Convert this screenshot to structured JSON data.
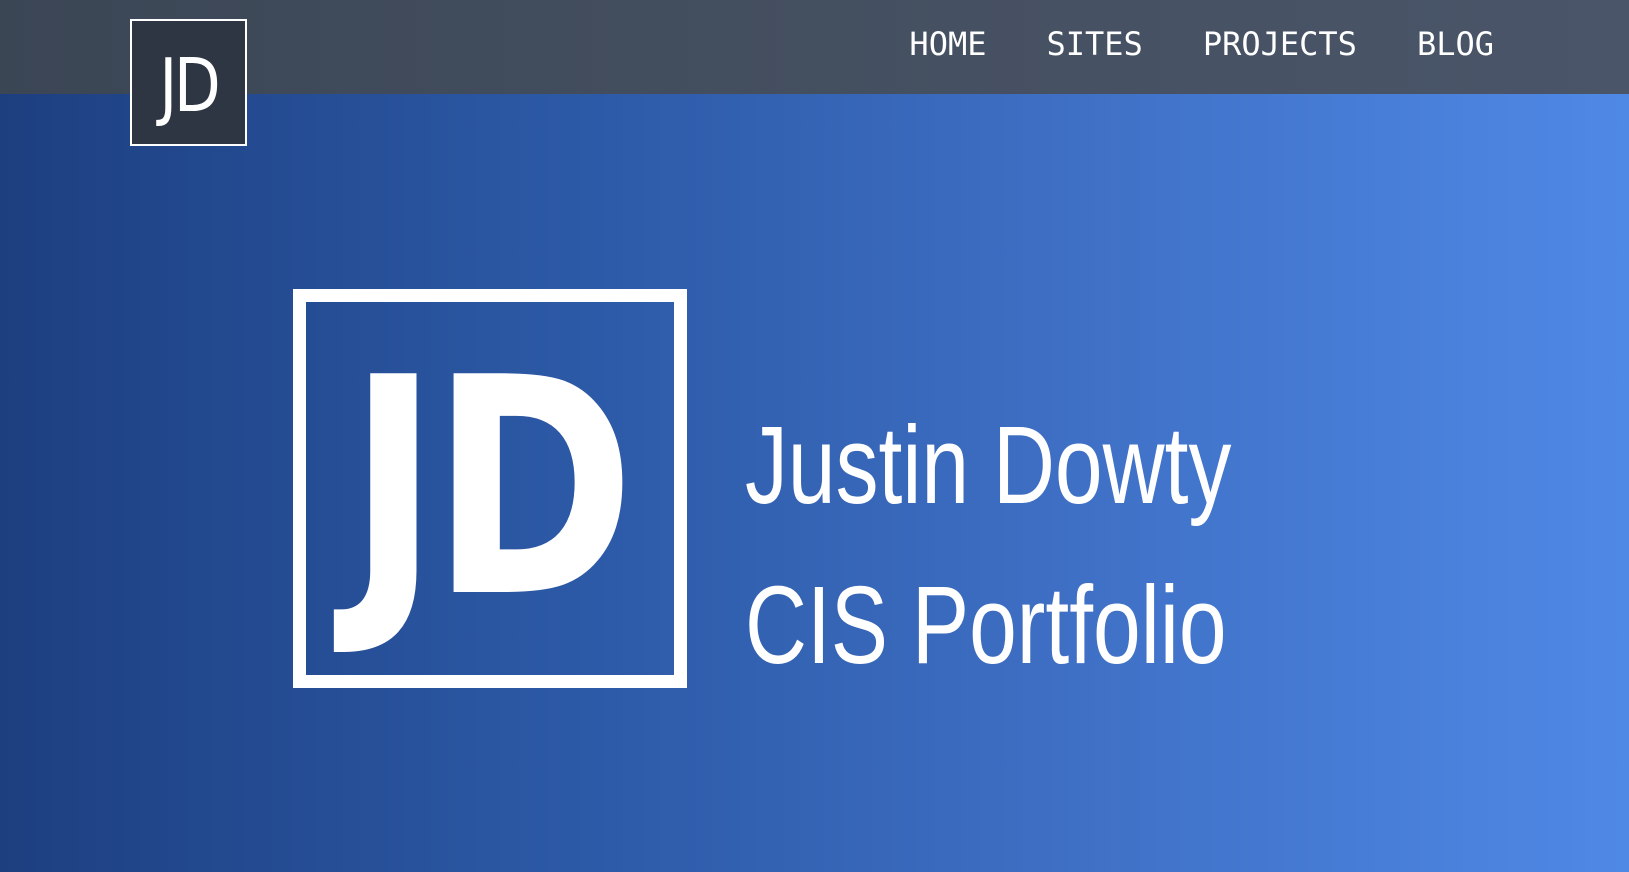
{
  "nav": {
    "logo_text": "JD",
    "links": [
      "HOME",
      "SITES",
      "PROJECTS",
      "BLOG"
    ]
  },
  "hero": {
    "logo_text": "JD",
    "title_line1": "Justin Dowty",
    "title_line2": "CIS Portfolio"
  },
  "colors": {
    "nav_background": "#444f60",
    "hero_gradient_start": "#1d3f80",
    "hero_gradient_end": "#4f89e6",
    "text": "#ffffff"
  }
}
